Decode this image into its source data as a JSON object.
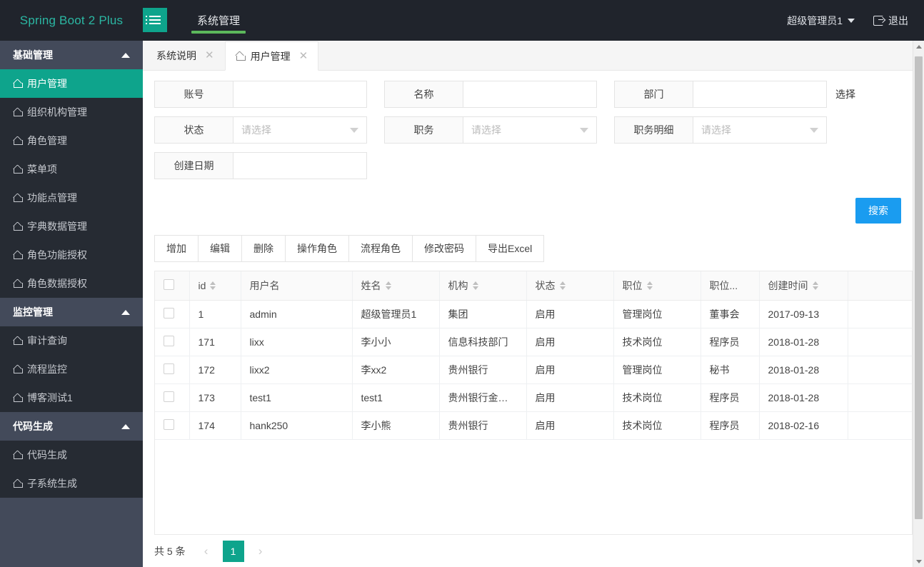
{
  "topbar": {
    "brand": "Spring Boot 2 Plus",
    "hamburger_icon": "menu-list-icon",
    "nav": [
      {
        "label": "系统管理",
        "active": true
      }
    ],
    "user_name": "超级管理员1",
    "user_caret_icon": "chevron-down-icon",
    "logout_icon": "logout-icon",
    "logout_label": "退出"
  },
  "sidebar": {
    "groups": [
      {
        "title": "基础管理",
        "collapse_icon": "chevron-up-icon",
        "items": [
          {
            "label": "用户管理",
            "icon": "home-icon",
            "active": true
          },
          {
            "label": "组织机构管理",
            "icon": "home-icon",
            "active": false
          },
          {
            "label": "角色管理",
            "icon": "home-icon",
            "active": false
          },
          {
            "label": "菜单项",
            "icon": "home-icon",
            "active": false
          },
          {
            "label": "功能点管理",
            "icon": "home-icon",
            "active": false
          },
          {
            "label": "字典数据管理",
            "icon": "home-icon",
            "active": false
          },
          {
            "label": "角色功能授权",
            "icon": "home-icon",
            "active": false
          },
          {
            "label": "角色数据授权",
            "icon": "home-icon",
            "active": false
          }
        ]
      },
      {
        "title": "监控管理",
        "collapse_icon": "chevron-up-icon",
        "items": [
          {
            "label": "审计查询",
            "icon": "home-icon",
            "active": false
          },
          {
            "label": "流程监控",
            "icon": "home-icon",
            "active": false
          },
          {
            "label": "博客测试1",
            "icon": "home-icon",
            "active": false
          }
        ]
      },
      {
        "title": "代码生成",
        "collapse_icon": "chevron-up-icon",
        "items": [
          {
            "label": "代码生成",
            "icon": "home-icon",
            "active": false
          },
          {
            "label": "子系统生成",
            "icon": "home-icon",
            "active": false
          }
        ]
      }
    ]
  },
  "tabs": [
    {
      "label": "系统说明",
      "active": false,
      "has_home_icon": false,
      "close_icon": "close-icon"
    },
    {
      "label": "用户管理",
      "active": true,
      "has_home_icon": true,
      "close_icon": "close-icon"
    }
  ],
  "search_form": {
    "fields": [
      {
        "label": "账号",
        "value": "",
        "placeholder": "",
        "type": "text"
      },
      {
        "label": "名称",
        "value": "",
        "placeholder": "",
        "type": "text"
      },
      {
        "label": "部门",
        "value": "",
        "placeholder": "",
        "type": "text"
      },
      {
        "label": "状态",
        "value": "请选择",
        "type": "select"
      },
      {
        "label": "职务",
        "value": "请选择",
        "type": "select"
      },
      {
        "label": "职务明细",
        "value": "请选择",
        "type": "select"
      },
      {
        "label": "创建日期",
        "value": "",
        "placeholder": "",
        "type": "text"
      }
    ],
    "pick_link": "选择",
    "search_button": "搜索",
    "search_button_color": "#1a9cf0"
  },
  "toolbar": {
    "buttons": [
      "增加",
      "编辑",
      "删除",
      "操作角色",
      "流程角色",
      "修改密码",
      "导出Excel"
    ]
  },
  "table": {
    "select_all_checkbox": false,
    "columns": [
      {
        "label": "",
        "sortable": false,
        "key": "check"
      },
      {
        "label": "id",
        "sortable": true,
        "key": "id"
      },
      {
        "label": "用户名",
        "sortable": false,
        "key": "username"
      },
      {
        "label": "姓名",
        "sortable": true,
        "key": "name"
      },
      {
        "label": "机构",
        "sortable": true,
        "key": "org"
      },
      {
        "label": "状态",
        "sortable": true,
        "key": "state"
      },
      {
        "label": "职位",
        "sortable": true,
        "key": "post"
      },
      {
        "label": "职位...",
        "sortable": false,
        "key": "postdetail"
      },
      {
        "label": "创建时间",
        "sortable": true,
        "key": "created"
      },
      {
        "label": "",
        "sortable": false,
        "key": "pad"
      }
    ],
    "rows": [
      {
        "check": false,
        "id": "1",
        "username": "admin",
        "name": "超级管理员1",
        "org": "集团",
        "state": "启用",
        "post": "管理岗位",
        "postdetail": "董事会",
        "created": "2017-09-13"
      },
      {
        "check": false,
        "id": "171",
        "username": "lixx",
        "name": "李小小",
        "org": "信息科技部门",
        "state": "启用",
        "post": "技术岗位",
        "postdetail": "程序员",
        "created": "2018-01-28"
      },
      {
        "check": false,
        "id": "172",
        "username": "lixx2",
        "name": "李xx2",
        "org": "贵州银行",
        "state": "启用",
        "post": "管理岗位",
        "postdetail": "秘书",
        "created": "2018-01-28"
      },
      {
        "check": false,
        "id": "173",
        "username": "test1",
        "name": "test1",
        "org": "贵州银行金…",
        "state": "启用",
        "post": "技术岗位",
        "postdetail": "程序员",
        "created": "2018-01-28"
      },
      {
        "check": false,
        "id": "174",
        "username": "hank250",
        "name": "李小熊",
        "org": "贵州银行",
        "state": "启用",
        "post": "技术岗位",
        "postdetail": "程序员",
        "created": "2018-02-16"
      }
    ]
  },
  "pagination": {
    "total_text": "共 5 条",
    "prev_icon": "chevron-left-icon",
    "next_icon": "chevron-right-icon",
    "pages": [
      "1"
    ],
    "current_page": "1",
    "active_color": "#0ea48c"
  },
  "scrollbar": {
    "up_icon": "scroll-up-icon",
    "down_icon": "scroll-down-icon"
  },
  "theme": {
    "header_bg": "#20242c",
    "sidebar_bg": "#434a5a",
    "submenu_bg": "#262b33",
    "accent": "#0ea48c",
    "nav_active_underline": "#5cb85c",
    "brand_color": "#2bb7a3"
  }
}
